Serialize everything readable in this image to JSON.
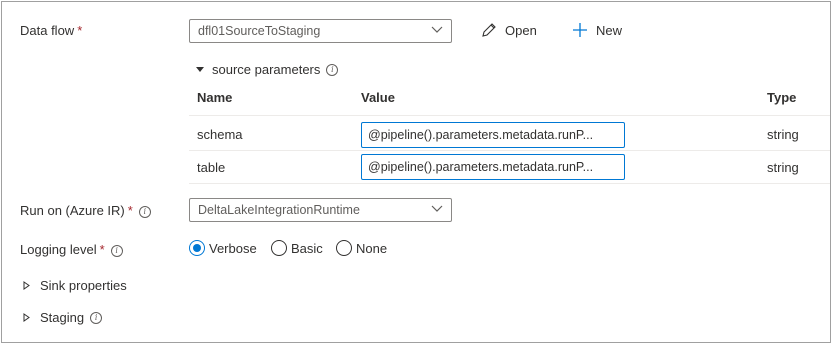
{
  "data_flow": {
    "label": "Data flow",
    "required_mark": "*",
    "selected": "dfl01SourceToStaging",
    "open_label": "Open",
    "new_label": "New"
  },
  "source_parameters": {
    "title": "source parameters",
    "columns": [
      "Name",
      "Value",
      "Type"
    ],
    "rows": [
      {
        "name": "schema",
        "value": "@pipeline().parameters.metadata.runP...",
        "type": "string"
      },
      {
        "name": "table",
        "value": "@pipeline().parameters.metadata.runP...",
        "type": "string"
      }
    ]
  },
  "run_on": {
    "label": "Run on (Azure IR)",
    "required_mark": "*",
    "selected": "DeltaLakeIntegrationRuntime"
  },
  "logging_level": {
    "label": "Logging level",
    "required_mark": "*",
    "options": [
      "Verbose",
      "Basic",
      "None"
    ],
    "selected": "Verbose"
  },
  "sink_properties": {
    "label": "Sink properties"
  },
  "staging": {
    "label": "Staging"
  },
  "colors": {
    "accent": "#0078d4",
    "required": "#a4262c",
    "text": "#323130",
    "border": "#8a8886"
  }
}
